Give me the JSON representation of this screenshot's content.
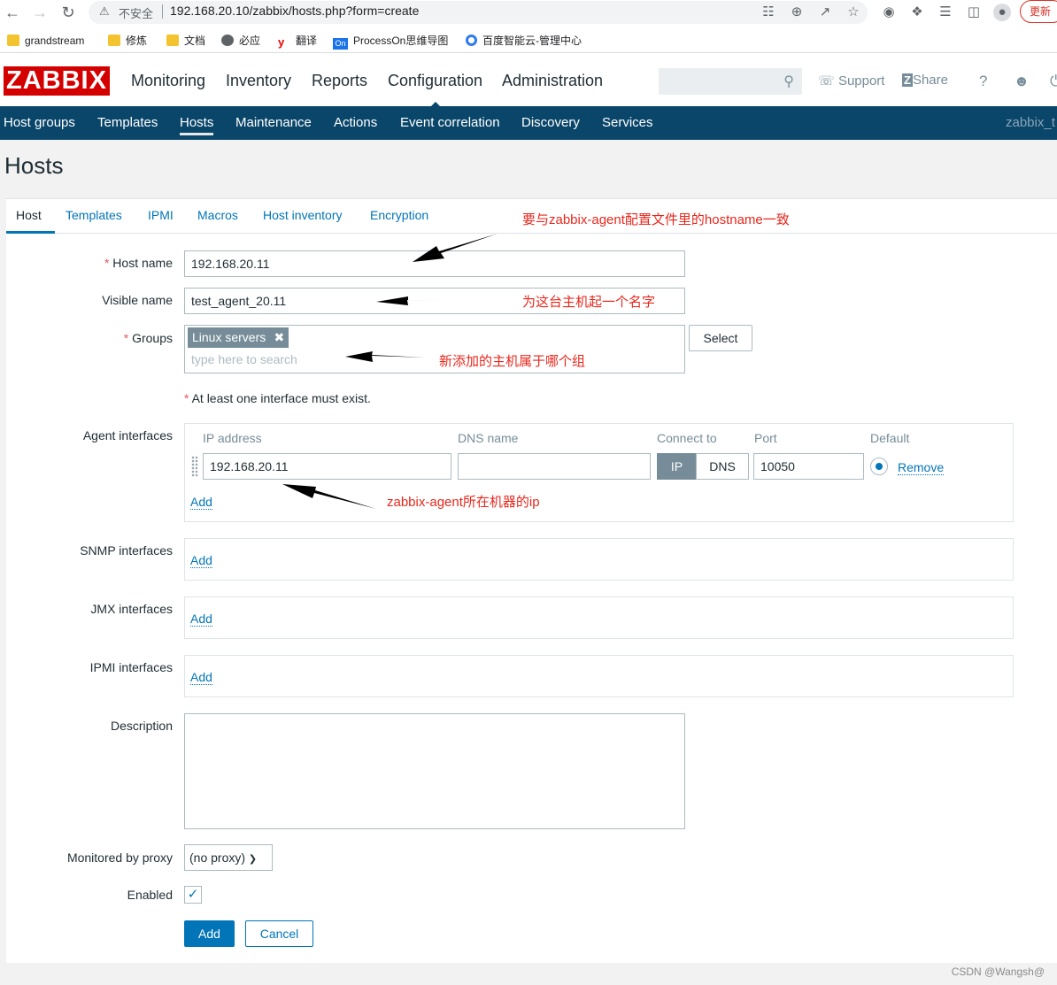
{
  "browser": {
    "insecure_label": "不安全",
    "url": "192.168.20.10/zabbix/hosts.php?form=create",
    "update_label": "更新",
    "bookmarks": [
      "grandstream",
      "修炼",
      "文档",
      "必应",
      "翻译",
      "ProcessOn思维导图",
      "百度智能云-管理中心"
    ]
  },
  "header": {
    "logo": "ZABBIX",
    "menu": [
      "Monitoring",
      "Inventory",
      "Reports",
      "Configuration",
      "Administration"
    ],
    "active_menu": "Configuration",
    "support": "Support",
    "share": "Share",
    "help": "?"
  },
  "subnav": {
    "items": [
      "Host groups",
      "Templates",
      "Hosts",
      "Maintenance",
      "Actions",
      "Event correlation",
      "Discovery",
      "Services"
    ],
    "active": "Hosts",
    "user": "zabbix_t"
  },
  "page_title": "Hosts",
  "tabs": [
    "Host",
    "Templates",
    "IPMI",
    "Macros",
    "Host inventory",
    "Encryption"
  ],
  "form": {
    "host_name_label": "Host name",
    "host_name_value": "192.168.20.11",
    "visible_name_label": "Visible name",
    "visible_name_value": "test_agent_20.11",
    "groups_label": "Groups",
    "group_chip": "Linux servers",
    "groups_placeholder": "type here to search",
    "select_button": "Select",
    "interface_note": "At least one interface must exist.",
    "agent_label": "Agent interfaces",
    "if_headers": [
      "IP address",
      "DNS name",
      "Connect to",
      "Port",
      "Default"
    ],
    "agent_ip": "192.168.20.11",
    "agent_dns": "",
    "connect_ip": "IP",
    "connect_dns": "DNS",
    "agent_port": "10050",
    "remove_link": "Remove",
    "add_link": "Add",
    "snmp_label": "SNMP interfaces",
    "jmx_label": "JMX interfaces",
    "ipmi_label": "IPMI interfaces",
    "description_label": "Description",
    "proxy_label": "Monitored by proxy",
    "proxy_value": "(no proxy)",
    "enabled_label": "Enabled",
    "enabled_checked": true,
    "add_button": "Add",
    "cancel_button": "Cancel"
  },
  "annotations": {
    "hostname_note": "要与zabbix-agent配置文件里的hostname一致",
    "visible_note": "为这台主机起一个名字",
    "group_note": "新添加的主机属于哪个组",
    "ip_note": "zabbix-agent所在机器的ip"
  },
  "watermark": "CSDN @Wangsh@",
  "colors": {
    "brand_red": "#d40000",
    "nav_blue": "#0a466a",
    "link_blue": "#0275b8",
    "annotation_red": "#e8271c"
  }
}
